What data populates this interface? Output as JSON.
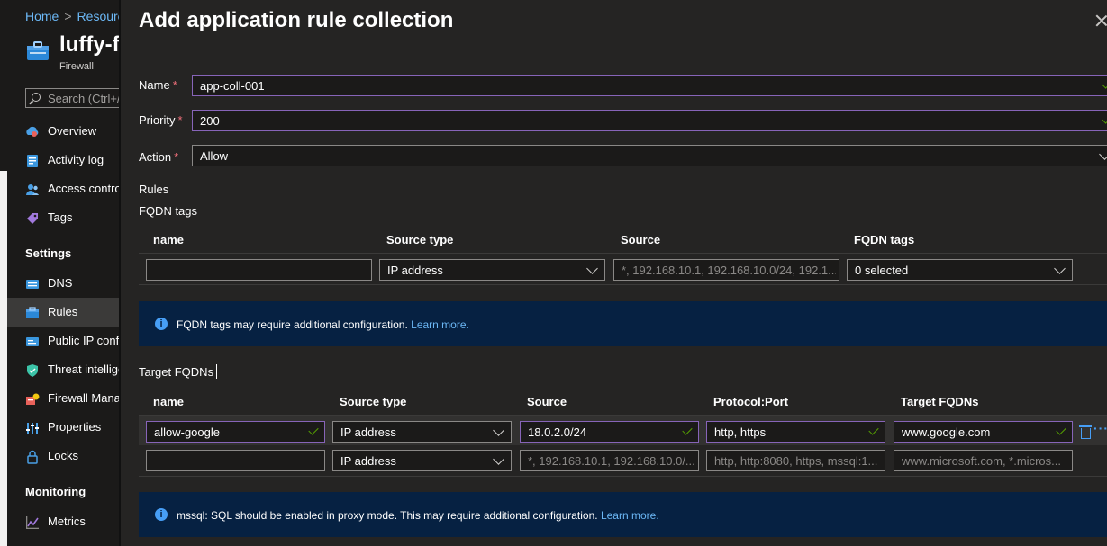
{
  "breadcrumb": {
    "home": "Home",
    "resource": "Resource",
    "sep": ">"
  },
  "resource": {
    "name": "luffy-fw",
    "type": "Firewall"
  },
  "search": {
    "placeholder": "Search (Ctrl+/)"
  },
  "nav": {
    "overview": "Overview",
    "activity_log": "Activity log",
    "access_control": "Access control (IAM)",
    "tags": "Tags",
    "settings_heading": "Settings",
    "dns": "DNS",
    "rules": "Rules",
    "public_ip": "Public IP configuration",
    "threat_intel": "Threat intelligence",
    "firewall_manager": "Firewall Manager",
    "properties": "Properties",
    "locks": "Locks",
    "monitoring_heading": "Monitoring",
    "metrics": "Metrics"
  },
  "panel": {
    "title": "Add application rule collection",
    "name_label": "Name",
    "name_value": "app-coll-001",
    "priority_label": "Priority",
    "priority_value": "200",
    "action_label": "Action",
    "action_value": "Allow",
    "rules_heading": "Rules",
    "fqdn_tags_heading": "FQDN tags",
    "target_fqdns_heading": "Target FQDNs"
  },
  "fqdn_tags_table": {
    "headers": [
      "name",
      "Source type",
      "Source",
      "FQDN tags"
    ],
    "row": {
      "name": "",
      "source_type": "IP address",
      "source_placeholder": "*, 192.168.10.1, 192.168.10.0/24, 192.1...",
      "fqdn_tags": "0 selected"
    }
  },
  "info1": {
    "text": "FQDN tags may require additional configuration.",
    "link": "Learn more."
  },
  "target_fqdns_table": {
    "headers": [
      "name",
      "Source type",
      "Source",
      "Protocol:Port",
      "Target FQDNs"
    ],
    "rows": [
      {
        "name": "allow-google",
        "source_type": "IP address",
        "source": "18.0.2.0/24",
        "protocol": "http, https",
        "target": "www.google.com"
      }
    ],
    "empty_row": {
      "source_type": "IP address",
      "source_placeholder": "*, 192.168.10.1, 192.168.10.0/...",
      "protocol_placeholder": "http, http:8080, https, mssql:1...",
      "target_placeholder": "www.microsoft.com, *.micros..."
    }
  },
  "info2": {
    "text": "mssql: SQL should be enabled in proxy mode. This may require additional configuration.",
    "link": "Learn more."
  },
  "colors": {
    "accent": "#479ef5",
    "valid_border": "#8764b8",
    "check": "#57a300",
    "required": "#f1707b",
    "info_bg": "#062142"
  }
}
